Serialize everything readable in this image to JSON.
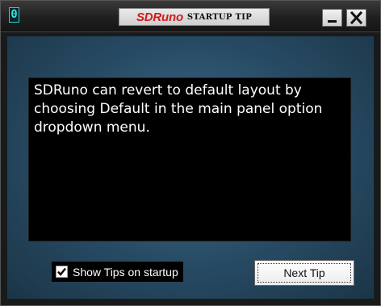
{
  "titlebar": {
    "app_icon_glyph": "0",
    "brand": "SDRuno",
    "title": "STARTUP TIP",
    "brand_color": "#d21a1a",
    "accent_color": "#35e0e0"
  },
  "window_controls": {
    "minimize_icon": "minimize-icon",
    "close_icon": "close-icon"
  },
  "tip": {
    "text": "SDRuno can revert to default layout by choosing Default in the main panel option dropdown menu."
  },
  "footer": {
    "show_tips_label": "Show Tips on startup",
    "show_tips_checked": true,
    "next_button_label": "Next Tip"
  }
}
